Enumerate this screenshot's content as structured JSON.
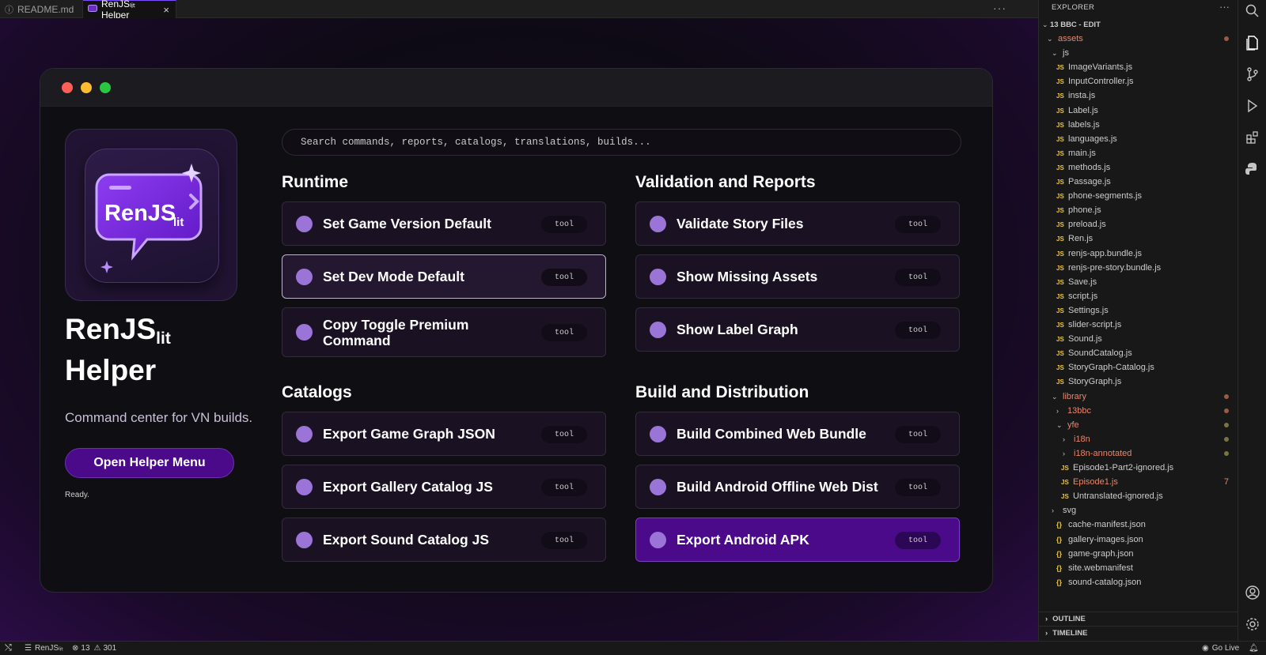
{
  "tabs": {
    "readme": {
      "label": "README.md",
      "icon": "info-icon"
    },
    "helper": {
      "label": "RenJSₗᵢₜ Helper",
      "close": "×"
    },
    "more": "···"
  },
  "helper": {
    "app_title_main": "RenJS",
    "app_title_sub": "lit",
    "app_title_line2": "Helper",
    "logo_text_main": "RenJS",
    "logo_text_sub": "lit",
    "tagline": "Command center for VN builds.",
    "open_menu_button": "Open Helper Menu",
    "status": "Ready.",
    "search_placeholder": "Search commands, reports, catalogs, translations, builds...",
    "sections": {
      "runtime": {
        "title": "Runtime",
        "items": [
          {
            "label": "Set Game Version Default",
            "badge": "tool"
          },
          {
            "label": "Set Dev Mode Default",
            "badge": "tool"
          },
          {
            "label": "Copy Toggle Premium Command",
            "badge": "tool"
          }
        ]
      },
      "validation": {
        "title": "Validation and Reports",
        "items": [
          {
            "label": "Validate Story Files",
            "badge": "tool"
          },
          {
            "label": "Show Missing Assets",
            "badge": "tool"
          },
          {
            "label": "Show Label Graph",
            "badge": "tool"
          }
        ]
      },
      "catalogs": {
        "title": "Catalogs",
        "items": [
          {
            "label": "Export Game Graph JSON",
            "badge": "tool"
          },
          {
            "label": "Export Gallery Catalog JS",
            "badge": "tool"
          },
          {
            "label": "Export Sound Catalog JS",
            "badge": "tool"
          }
        ]
      },
      "build": {
        "title": "Build and Distribution",
        "items": [
          {
            "label": "Build Combined Web Bundle",
            "badge": "tool"
          },
          {
            "label": "Build Android Offline Web Dist",
            "badge": "tool"
          },
          {
            "label": "Export Android APK",
            "badge": "tool"
          }
        ]
      }
    }
  },
  "explorer": {
    "header": "EXPLORER",
    "more": "···",
    "root": "13 BBC - EDIT",
    "rows": [
      {
        "name": "assets",
        "kind": "folder-open",
        "git": true,
        "mark": "red"
      },
      {
        "name": "js",
        "kind": "folder-open"
      },
      {
        "name": "ImageVariants.js",
        "kind": "js"
      },
      {
        "name": "InputController.js",
        "kind": "js"
      },
      {
        "name": "insta.js",
        "kind": "js"
      },
      {
        "name": "Label.js",
        "kind": "js"
      },
      {
        "name": "labels.js",
        "kind": "js"
      },
      {
        "name": "languages.js",
        "kind": "js"
      },
      {
        "name": "main.js",
        "kind": "js"
      },
      {
        "name": "methods.js",
        "kind": "js"
      },
      {
        "name": "Passage.js",
        "kind": "js"
      },
      {
        "name": "phone-segments.js",
        "kind": "js"
      },
      {
        "name": "phone.js",
        "kind": "js"
      },
      {
        "name": "preload.js",
        "kind": "js"
      },
      {
        "name": "Ren.js",
        "kind": "js"
      },
      {
        "name": "renjs-app.bundle.js",
        "kind": "js"
      },
      {
        "name": "renjs-pre-story.bundle.js",
        "kind": "js"
      },
      {
        "name": "Save.js",
        "kind": "js"
      },
      {
        "name": "script.js",
        "kind": "js"
      },
      {
        "name": "Settings.js",
        "kind": "js"
      },
      {
        "name": "slider-script.js",
        "kind": "js"
      },
      {
        "name": "Sound.js",
        "kind": "js"
      },
      {
        "name": "SoundCatalog.js",
        "kind": "js"
      },
      {
        "name": "StoryGraph-Catalog.js",
        "kind": "js"
      },
      {
        "name": "StoryGraph.js",
        "kind": "js"
      },
      {
        "name": "library",
        "kind": "folder-open",
        "git": true,
        "mark": "red"
      },
      {
        "name": "13bbc",
        "kind": "folder-closed",
        "git": true,
        "mark": "red"
      },
      {
        "name": "yfe",
        "kind": "folder-open",
        "git": true,
        "mark": "olive"
      },
      {
        "name": "i18n",
        "kind": "folder-closed",
        "git": true,
        "mark": "olive"
      },
      {
        "name": "i18n-annotated",
        "kind": "folder-closed",
        "git": true,
        "mark": "olive"
      },
      {
        "name": "Episode1-Part2-ignored.js",
        "kind": "js"
      },
      {
        "name": "Episode1.js",
        "kind": "js",
        "git": true,
        "num": "7"
      },
      {
        "name": "Untranslated-ignored.js",
        "kind": "js"
      },
      {
        "name": "svg",
        "kind": "folder-closed"
      },
      {
        "name": "cache-manifest.json",
        "kind": "json"
      },
      {
        "name": "gallery-images.json",
        "kind": "json"
      },
      {
        "name": "game-graph.json",
        "kind": "json"
      },
      {
        "name": "site.webmanifest",
        "kind": "json"
      },
      {
        "name": "sound-catalog.json",
        "kind": "json"
      }
    ],
    "outline": "OUTLINE",
    "timeline": "TIMELINE"
  },
  "statusbar": {
    "project": "RenJSₗᵢₜ",
    "errors": "13",
    "warnings": "301",
    "go_live": "Go Live"
  },
  "colors": {
    "accent": "#4b0a8a",
    "bullet": "#9b74d8",
    "git_modified": "#e4886f",
    "js_icon": "#e8c441"
  }
}
